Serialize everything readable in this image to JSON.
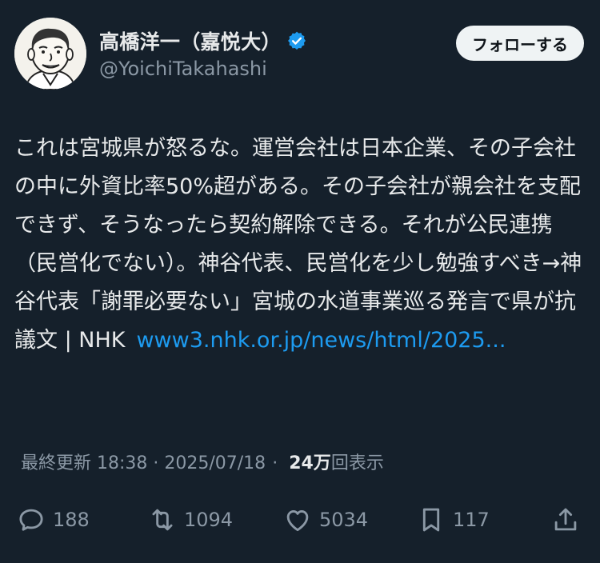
{
  "author": {
    "display_name": "高橋洋一（嘉悦大）",
    "handle": "@YoichiTakahashi",
    "verified_icon": "verified-badge-icon",
    "avatar": "caricature-avatar"
  },
  "follow_button_label": "フォローする",
  "post": {
    "text": "これは宮城県が怒るな。運営会社は日本企業、その子会社の中に外資比率50%超がある。その子会社が親会社を支配できず、そうなったら契約解除できる。それが公民連携（民営化でない）。神谷代表、民営化を少し勉強すべき→神谷代表「謝罪必要ない」宮城の水道事業巡る発言で県が抗議文 | NHK",
    "link_text": "www3.nhk.or.jp/news/html/2025..."
  },
  "meta": {
    "timestamp": "最終更新 18:38 · 2025/07/18",
    "separator": "·",
    "views_count": "24万",
    "views_label": "回表示"
  },
  "actions": {
    "replies": "188",
    "reposts": "1094",
    "likes": "5034",
    "bookmarks": "117"
  },
  "colors": {
    "background": "#15202b",
    "text": "#e7e9ea",
    "secondary": "#8b98a5",
    "link": "#1d9bf0",
    "verified": "#1d9bf0"
  }
}
